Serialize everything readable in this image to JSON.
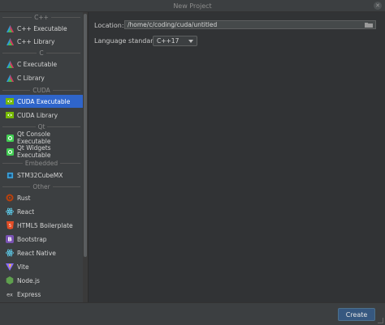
{
  "window": {
    "title": "New Project",
    "close_glyph": "✕"
  },
  "sidebar": {
    "groups": [
      {
        "label": "C++"
      },
      {
        "label": "C"
      },
      {
        "label": "CUDA"
      },
      {
        "label": "Qt"
      },
      {
        "label": "Embedded"
      },
      {
        "label": "Other"
      }
    ],
    "items": [
      {
        "label": "C++ Executable",
        "icon": "triangle-icon"
      },
      {
        "label": "C++ Library",
        "icon": "triangle-icon"
      },
      {
        "label": "C Executable",
        "icon": "triangle-icon"
      },
      {
        "label": "C Library",
        "icon": "triangle-icon"
      },
      {
        "label": "CUDA Executable",
        "icon": "nvidia-icon",
        "selected": true
      },
      {
        "label": "CUDA Library",
        "icon": "nvidia-icon"
      },
      {
        "label": "Qt Console Executable",
        "icon": "qt-icon"
      },
      {
        "label": "Qt Widgets Executable",
        "icon": "qt-icon"
      },
      {
        "label": "STM32CubeMX",
        "icon": "stm32-icon"
      },
      {
        "label": "Rust",
        "icon": "rust-icon"
      },
      {
        "label": "React",
        "icon": "react-icon"
      },
      {
        "label": "HTML5 Boilerplate",
        "icon": "html5-icon"
      },
      {
        "label": "Bootstrap",
        "icon": "bootstrap-icon"
      },
      {
        "label": "React Native",
        "icon": "react-icon"
      },
      {
        "label": "Vite",
        "icon": "vite-icon"
      },
      {
        "label": "Node.js",
        "icon": "nodejs-icon"
      },
      {
        "label": "Express",
        "icon": "express-icon"
      }
    ]
  },
  "form": {
    "location_label": "Location:",
    "location_value": "/home/c/coding/cuda/untitled",
    "language_label": "Language standard:",
    "language_value": "C++17"
  },
  "footer": {
    "create_label": "Create"
  },
  "colors": {
    "accent": "#2f65ca",
    "panel": "#3c3f41",
    "main": "#313335",
    "button": "#365880"
  }
}
